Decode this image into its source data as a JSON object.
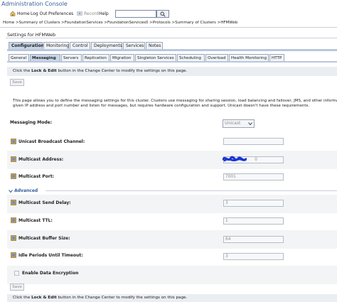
{
  "app": {
    "title": "Administration Console"
  },
  "toolbar": {
    "home": "Home",
    "logout": "Log Out",
    "preferences": "Preferences",
    "record": "Record",
    "help": "Help",
    "search_value": ""
  },
  "breadcrumb": "Home >Summary of Clusters >FoundationServices >FoundationServices0 >Protocols >Summary of Clusters >HFMWeb",
  "settings_heading": "Settings for HFMWeb",
  "tabs_primary": [
    "Configuration",
    "Monitoring",
    "Control",
    "Deployments",
    "Services",
    "Notes"
  ],
  "tabs_secondary": [
    "General",
    "Messaging",
    "Servers",
    "Replication",
    "Migration",
    "Singleton Services",
    "Scheduling",
    "Overload",
    "Health Monitoring",
    "HTTP"
  ],
  "change_center": {
    "line_pre": "Click the ",
    "line_bold": "Lock & Edit",
    "line_post": " button in the Change Center to modify the settings on this page."
  },
  "save_label": "Save",
  "description": [
    "This page allows you to define the messaging settings for this cluster. Clusters use messaging for sharing session, load balancing and failover, JMS, and other information",
    "given IP address and port number and listen for messages, but requires hardware configuration and support. Unicast doesn't have these requirements."
  ],
  "fields": {
    "messaging_mode": {
      "label": "Messaging Mode:",
      "value": "Unicast"
    },
    "unicast_channel": {
      "label": "Unicast Broadcast Channel:",
      "value": ""
    },
    "multicast_address": {
      "label": "Multicast Address:",
      "value": "0"
    },
    "multicast_port": {
      "label": "Multicast Port:",
      "value": "7001"
    },
    "advanced_label": "Advanced",
    "send_delay": {
      "label": "Multicast Send Delay:",
      "value": "3"
    },
    "ttl": {
      "label": "Multicast TTL:",
      "value": "1"
    },
    "buffer_size": {
      "label": "Multicast Buffer Size:",
      "value": "64"
    },
    "idle_periods": {
      "label": "Idle Periods Until Timeout:",
      "value": "3"
    },
    "encryption": {
      "label": "Enable Data Encryption"
    }
  },
  "colors": {
    "accent": "#3b5f9a",
    "tab_active": "#c9d6e8",
    "band": "#eaedf2",
    "scribble": "#1a35d6"
  },
  "icons": [
    "home-icon",
    "record-icon",
    "search-icon",
    "field-info-icon",
    "chevron-down-icon",
    "collapse-arrow-icon"
  ]
}
